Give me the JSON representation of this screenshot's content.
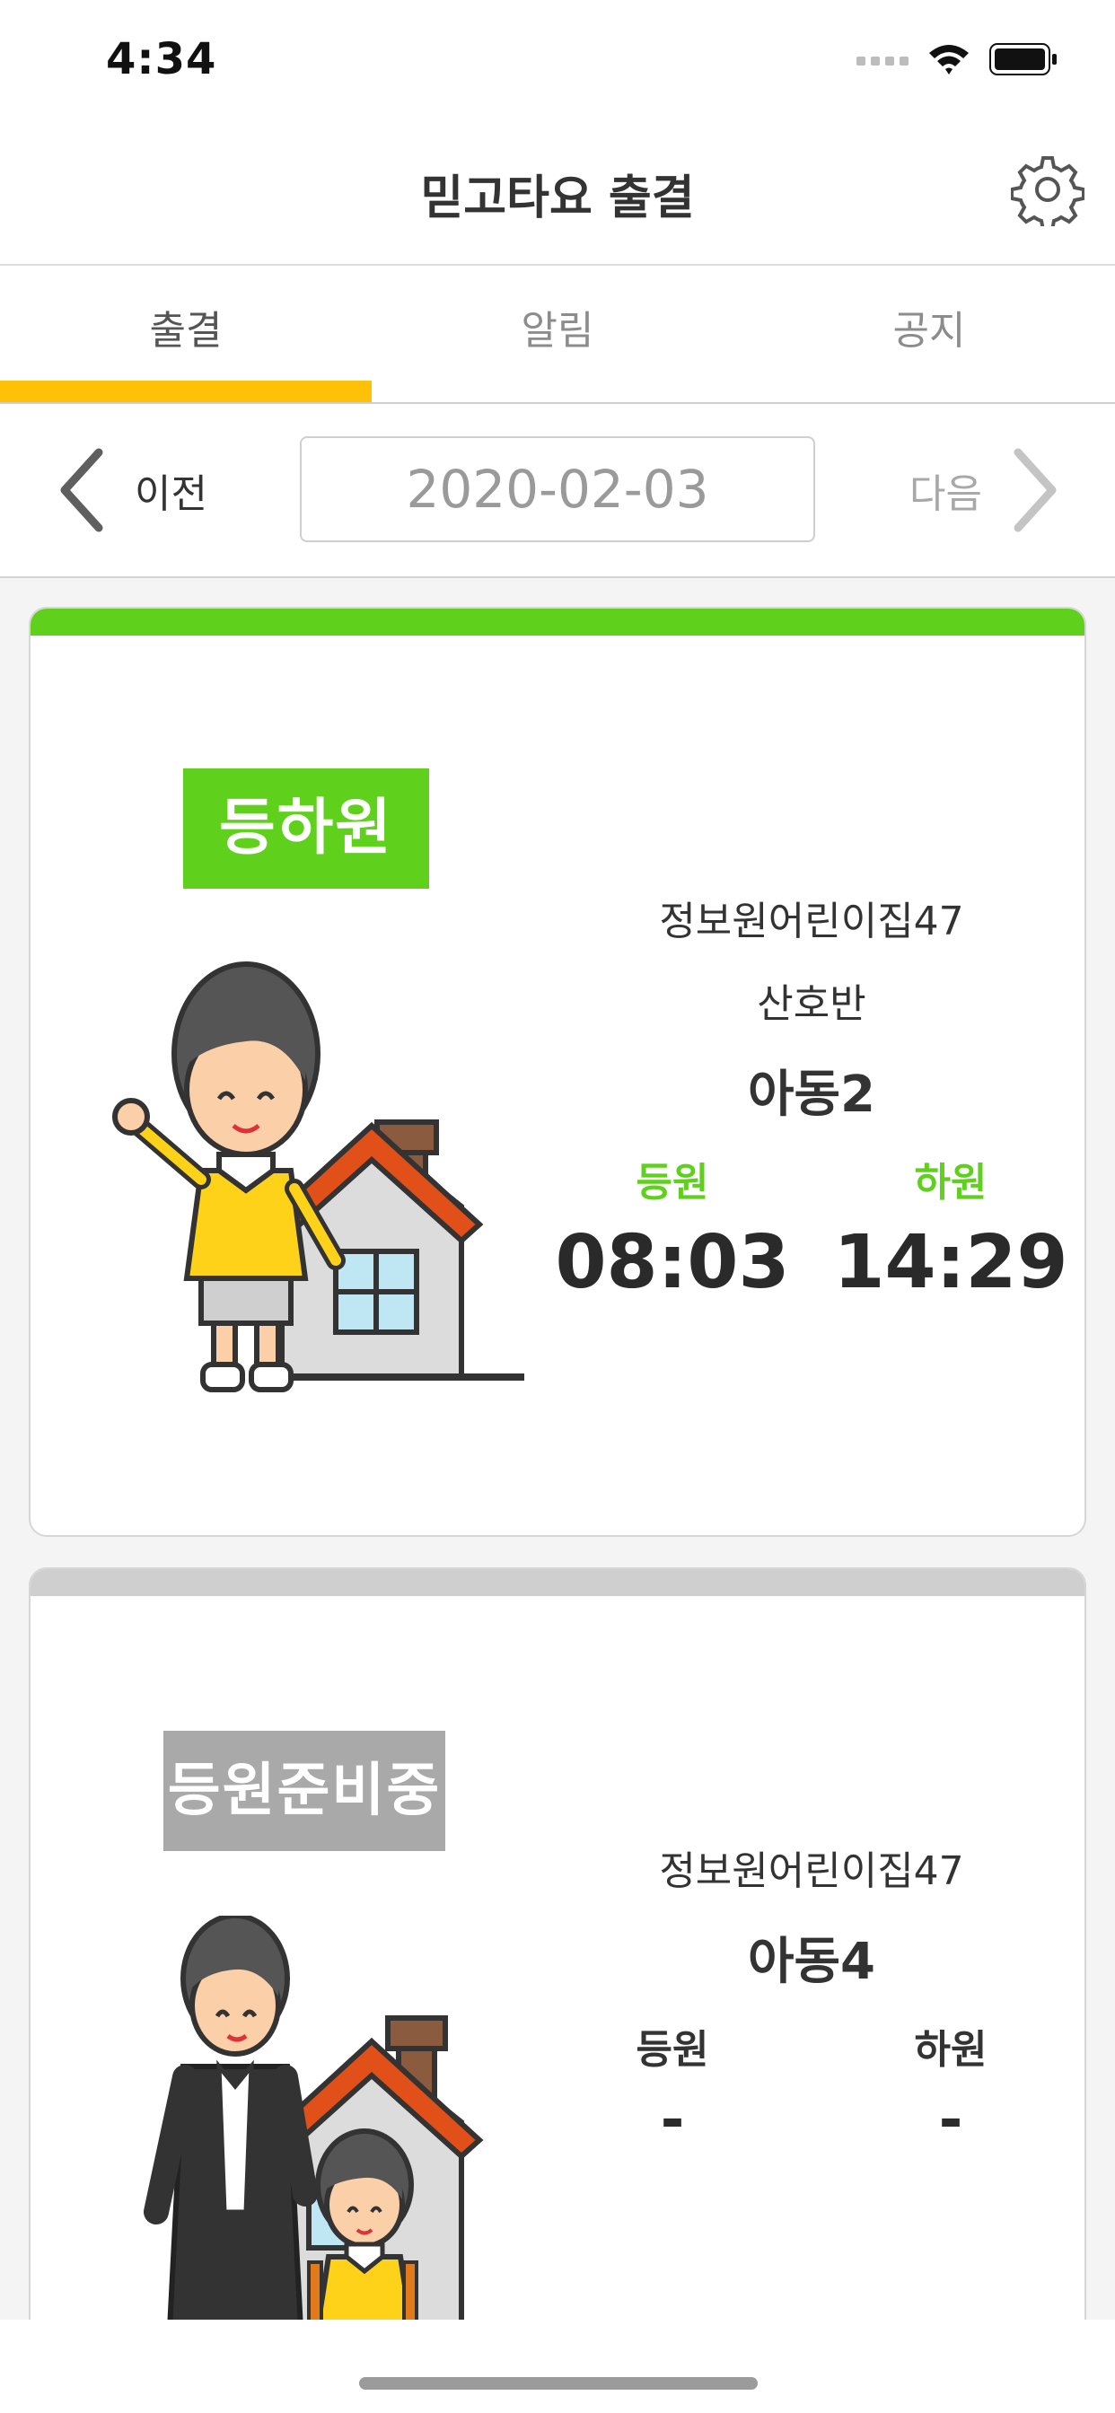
{
  "status_bar": {
    "time": "4:34"
  },
  "header": {
    "title": "믿고타요 출결",
    "settings_icon": "gear-icon"
  },
  "tabs": [
    {
      "label": "출결",
      "active": true
    },
    {
      "label": "알림",
      "active": false
    },
    {
      "label": "공지",
      "active": false
    }
  ],
  "date_nav": {
    "prev_label": "이전",
    "date": "2020-02-03",
    "next_label": "다음"
  },
  "cards": [
    {
      "accent_color": "#5fd11d",
      "badge": "등하원",
      "badge_color": "#5fd11d",
      "institution": "정보원어린이집47",
      "class_name": "산호반",
      "child_name": "아동2",
      "arrival_label": "등원",
      "arrival_time": "08:03",
      "departure_label": "하원",
      "departure_time": "14:29",
      "label_color": "#5fd11d"
    },
    {
      "accent_color": "#cfcfcf",
      "badge": "등원준비중",
      "badge_color": "#a9a9a9",
      "institution": "정보원어린이집47",
      "child_name": "아동4",
      "arrival_label": "등원",
      "arrival_time": "-",
      "departure_label": "하원",
      "departure_time": "-",
      "label_color": "#333333"
    }
  ]
}
